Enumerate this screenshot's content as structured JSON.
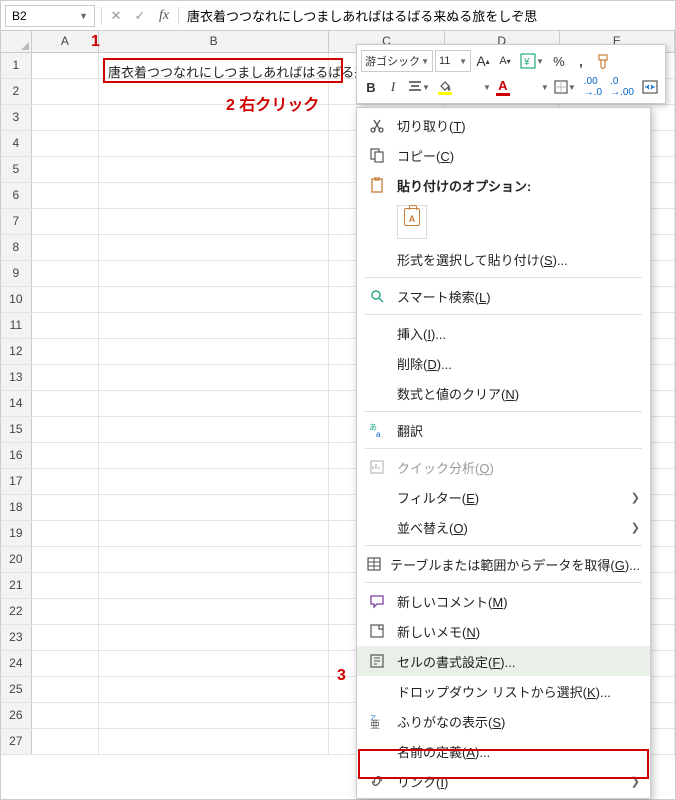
{
  "name_box": "B2",
  "formula_text": "唐衣着つつなれにしつましあればはるばる来ぬる旅をしぞ思",
  "columns": [
    "A",
    "B",
    "C",
    "D",
    "E"
  ],
  "row_count": 27,
  "cell_b2": "唐衣着つつなれにしつましあればはるばる来ぬる旅をしぞ思ふ",
  "annotations": {
    "a1": "1",
    "a2": "2 右クリック",
    "a3": "3"
  },
  "mini_toolbar": {
    "font_name": "游ゴシック",
    "font_size": "11",
    "increase_font": "A",
    "decrease_font": "A",
    "percent": "%",
    "comma": ",",
    "bold": "B",
    "italic": "I"
  },
  "context_menu": {
    "cut": "切り取り(T)",
    "copy": "コピー(C)",
    "paste_options": "貼り付けのオプション:",
    "paste_special": "形式を選択して貼り付け(S)...",
    "smart_lookup": "スマート検索(L)",
    "insert": "挿入(I)...",
    "delete": "削除(D)...",
    "clear": "数式と値のクリア(N)",
    "translate": "翻訳",
    "quick_analysis": "クイック分析(Q)",
    "filter": "フィルター(E)",
    "sort": "並べ替え(O)",
    "get_data": "テーブルまたは範囲からデータを取得(G)...",
    "new_comment": "新しいコメント(M)",
    "new_note": "新しいメモ(N)",
    "format_cells": "セルの書式設定(F)...",
    "dropdown_list": "ドロップダウン リストから選択(K)...",
    "show_furigana": "ふりがなの表示(S)",
    "define_name": "名前の定義(A)...",
    "link": "リンク(I)"
  }
}
